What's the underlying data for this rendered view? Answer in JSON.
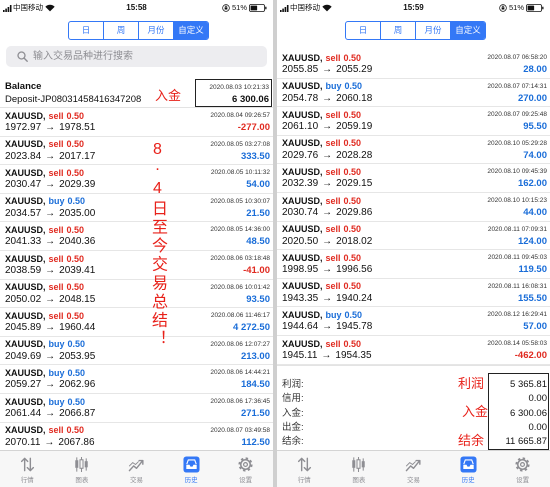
{
  "colors": {
    "accent": "#3478f6",
    "buy": "#1a6dd8",
    "sell": "#e02a20",
    "loss": "#e02a20",
    "annotation": "#e8211a",
    "icon_gray": "#8e8e93"
  },
  "period_tabs": [
    {
      "label": "日"
    },
    {
      "label": "周"
    },
    {
      "label": "月份"
    },
    {
      "label": "自定义",
      "selected": true
    }
  ],
  "bottom_nav": [
    {
      "label": "行情",
      "icon": "quotes-icon"
    },
    {
      "label": "图表",
      "icon": "chart-icon"
    },
    {
      "label": "交易",
      "icon": "trade-icon"
    },
    {
      "label": "历史",
      "icon": "history-icon",
      "active": true
    },
    {
      "label": "设置",
      "icon": "settings-icon"
    }
  ],
  "left": {
    "status": {
      "carrier": "中国移动",
      "time": "15:58",
      "battery": "51%"
    },
    "search": {
      "placeholder": "输入交易品种进行搜索"
    },
    "balance": {
      "label": "Balance",
      "comment": "Deposit-JP08031458416347208",
      "time": "2020.08.03 10:21:33",
      "amount": "6 300.06"
    },
    "trades": [
      {
        "symbol": "XAUUSD",
        "side": "sell",
        "volume": "0.50",
        "open": "1972.97",
        "close": "1978.51",
        "time": "2020.08.04 09:26:57",
        "profit": "-277.00"
      },
      {
        "symbol": "XAUUSD",
        "side": "sell",
        "volume": "0.50",
        "open": "2023.84",
        "close": "2017.17",
        "time": "2020.08.05 03:27:08",
        "profit": "333.50"
      },
      {
        "symbol": "XAUUSD",
        "side": "sell",
        "volume": "0.50",
        "open": "2030.47",
        "close": "2029.39",
        "time": "2020.08.05 10:11:32",
        "profit": "54.00"
      },
      {
        "symbol": "XAUUSD",
        "side": "buy",
        "volume": "0.50",
        "open": "2034.57",
        "close": "2035.00",
        "time": "2020.08.05 10:30:07",
        "profit": "21.50"
      },
      {
        "symbol": "XAUUSD",
        "side": "sell",
        "volume": "0.50",
        "open": "2041.33",
        "close": "2040.36",
        "time": "2020.08.05 14:36:00",
        "profit": "48.50"
      },
      {
        "symbol": "XAUUSD",
        "side": "sell",
        "volume": "0.50",
        "open": "2038.59",
        "close": "2039.41",
        "time": "2020.08.06 03:18:48",
        "profit": "-41.00"
      },
      {
        "symbol": "XAUUSD",
        "side": "sell",
        "volume": "0.50",
        "open": "2050.02",
        "close": "2048.15",
        "time": "2020.08.06 10:01:42",
        "profit": "93.50"
      },
      {
        "symbol": "XAUUSD",
        "side": "sell",
        "volume": "0.50",
        "open": "2045.89",
        "close": "1960.44",
        "time": "2020.08.06 11:46:17",
        "profit": "4 272.50"
      },
      {
        "symbol": "XAUUSD",
        "side": "buy",
        "volume": "0.50",
        "open": "2049.69",
        "close": "2053.95",
        "time": "2020.08.06 12:07:27",
        "profit": "213.00"
      },
      {
        "symbol": "XAUUSD",
        "side": "buy",
        "volume": "0.50",
        "open": "2059.27",
        "close": "2062.96",
        "time": "2020.08.06 14:44:21",
        "profit": "184.50"
      },
      {
        "symbol": "XAUUSD",
        "side": "buy",
        "volume": "0.50",
        "open": "2061.44",
        "close": "2066.87",
        "time": "2020.08.06 17:36:45",
        "profit": "271.50"
      },
      {
        "symbol": "XAUUSD",
        "side": "sell",
        "volume": "0.50",
        "open": "2070.11",
        "close": "2067.86",
        "time": "2020.08.07 03:49:58",
        "profit": "112.50"
      }
    ]
  },
  "right": {
    "status": {
      "carrier": "中国移动",
      "time": "15:59",
      "battery": "51%"
    },
    "trades": [
      {
        "symbol": "XAUUSD",
        "side": "sell",
        "volume": "0.50",
        "open": "2055.85",
        "close": "2055.29",
        "time": "2020.08.07 06:58:20",
        "profit": "28.00"
      },
      {
        "symbol": "XAUUSD",
        "side": "buy",
        "volume": "0.50",
        "open": "2054.78",
        "close": "2060.18",
        "time": "2020.08.07 07:14:31",
        "profit": "270.00"
      },
      {
        "symbol": "XAUUSD",
        "side": "sell",
        "volume": "0.50",
        "open": "2061.10",
        "close": "2059.19",
        "time": "2020.08.07 09:25:48",
        "profit": "95.50"
      },
      {
        "symbol": "XAUUSD",
        "side": "sell",
        "volume": "0.50",
        "open": "2029.76",
        "close": "2028.28",
        "time": "2020.08.10 05:29:28",
        "profit": "74.00"
      },
      {
        "symbol": "XAUUSD",
        "side": "sell",
        "volume": "0.50",
        "open": "2032.39",
        "close": "2029.15",
        "time": "2020.08.10 09:45:39",
        "profit": "162.00"
      },
      {
        "symbol": "XAUUSD",
        "side": "sell",
        "volume": "0.50",
        "open": "2030.74",
        "close": "2029.86",
        "time": "2020.08.10 10:15:23",
        "profit": "44.00"
      },
      {
        "symbol": "XAUUSD",
        "side": "sell",
        "volume": "0.50",
        "open": "2020.50",
        "close": "2018.02",
        "time": "2020.08.11 07:09:31",
        "profit": "124.00"
      },
      {
        "symbol": "XAUUSD",
        "side": "sell",
        "volume": "0.50",
        "open": "1998.95",
        "close": "1996.56",
        "time": "2020.08.11 09:45:03",
        "profit": "119.50"
      },
      {
        "symbol": "XAUUSD",
        "side": "sell",
        "volume": "0.50",
        "open": "1943.35",
        "close": "1940.24",
        "time": "2020.08.11 16:08:31",
        "profit": "155.50"
      },
      {
        "symbol": "XAUUSD",
        "side": "buy",
        "volume": "0.50",
        "open": "1944.64",
        "close": "1945.78",
        "time": "2020.08.12 16:29:41",
        "profit": "57.00"
      },
      {
        "symbol": "XAUUSD",
        "side": "sell",
        "volume": "0.50",
        "open": "1945.11",
        "close": "1954.35",
        "time": "2020.08.14 05:58:03",
        "profit": "-462.00"
      }
    ],
    "summary": [
      {
        "label": "利润:",
        "value": "5 365.81"
      },
      {
        "label": "信用:",
        "value": "0.00"
      },
      {
        "label": "入金:",
        "value": "6 300.06"
      },
      {
        "label": "出金:",
        "value": "0.00"
      },
      {
        "label": "结余:",
        "value": "11 665.87"
      }
    ]
  },
  "annotations": {
    "left_deposit": "入金",
    "left_summary": "8·4日至今交易总结！",
    "right_profit": "利润",
    "right_deposit": "入金",
    "right_balance": "结余"
  }
}
